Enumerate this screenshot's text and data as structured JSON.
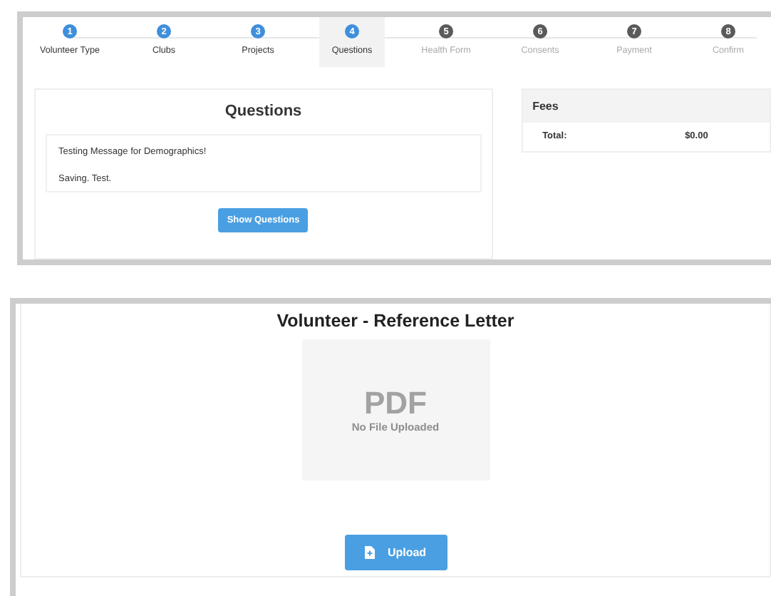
{
  "steps": [
    {
      "number": "1",
      "label": "Volunteer Type",
      "completed": true,
      "selected": false
    },
    {
      "number": "2",
      "label": "Clubs",
      "completed": true,
      "selected": false
    },
    {
      "number": "3",
      "label": "Projects",
      "completed": true,
      "selected": false
    },
    {
      "number": "4",
      "label": "Questions",
      "completed": true,
      "selected": true
    },
    {
      "number": "5",
      "label": "Health Form",
      "completed": false,
      "selected": false
    },
    {
      "number": "6",
      "label": "Consents",
      "completed": false,
      "selected": false
    },
    {
      "number": "7",
      "label": "Payment",
      "completed": false,
      "selected": false
    },
    {
      "number": "8",
      "label": "Confirm",
      "completed": false,
      "selected": false
    }
  ],
  "questions": {
    "title": "Questions",
    "messages": [
      "Testing Message for Demographics!",
      "Saving. Test."
    ],
    "button": "Show Questions"
  },
  "fees": {
    "title": "Fees",
    "total_label": "Total:",
    "total_value": "$0.00"
  },
  "document": {
    "title": "Volunteer - Reference Letter",
    "preview_type": "PDF",
    "preview_status": "No File Uploaded",
    "upload_button": "Upload"
  }
}
